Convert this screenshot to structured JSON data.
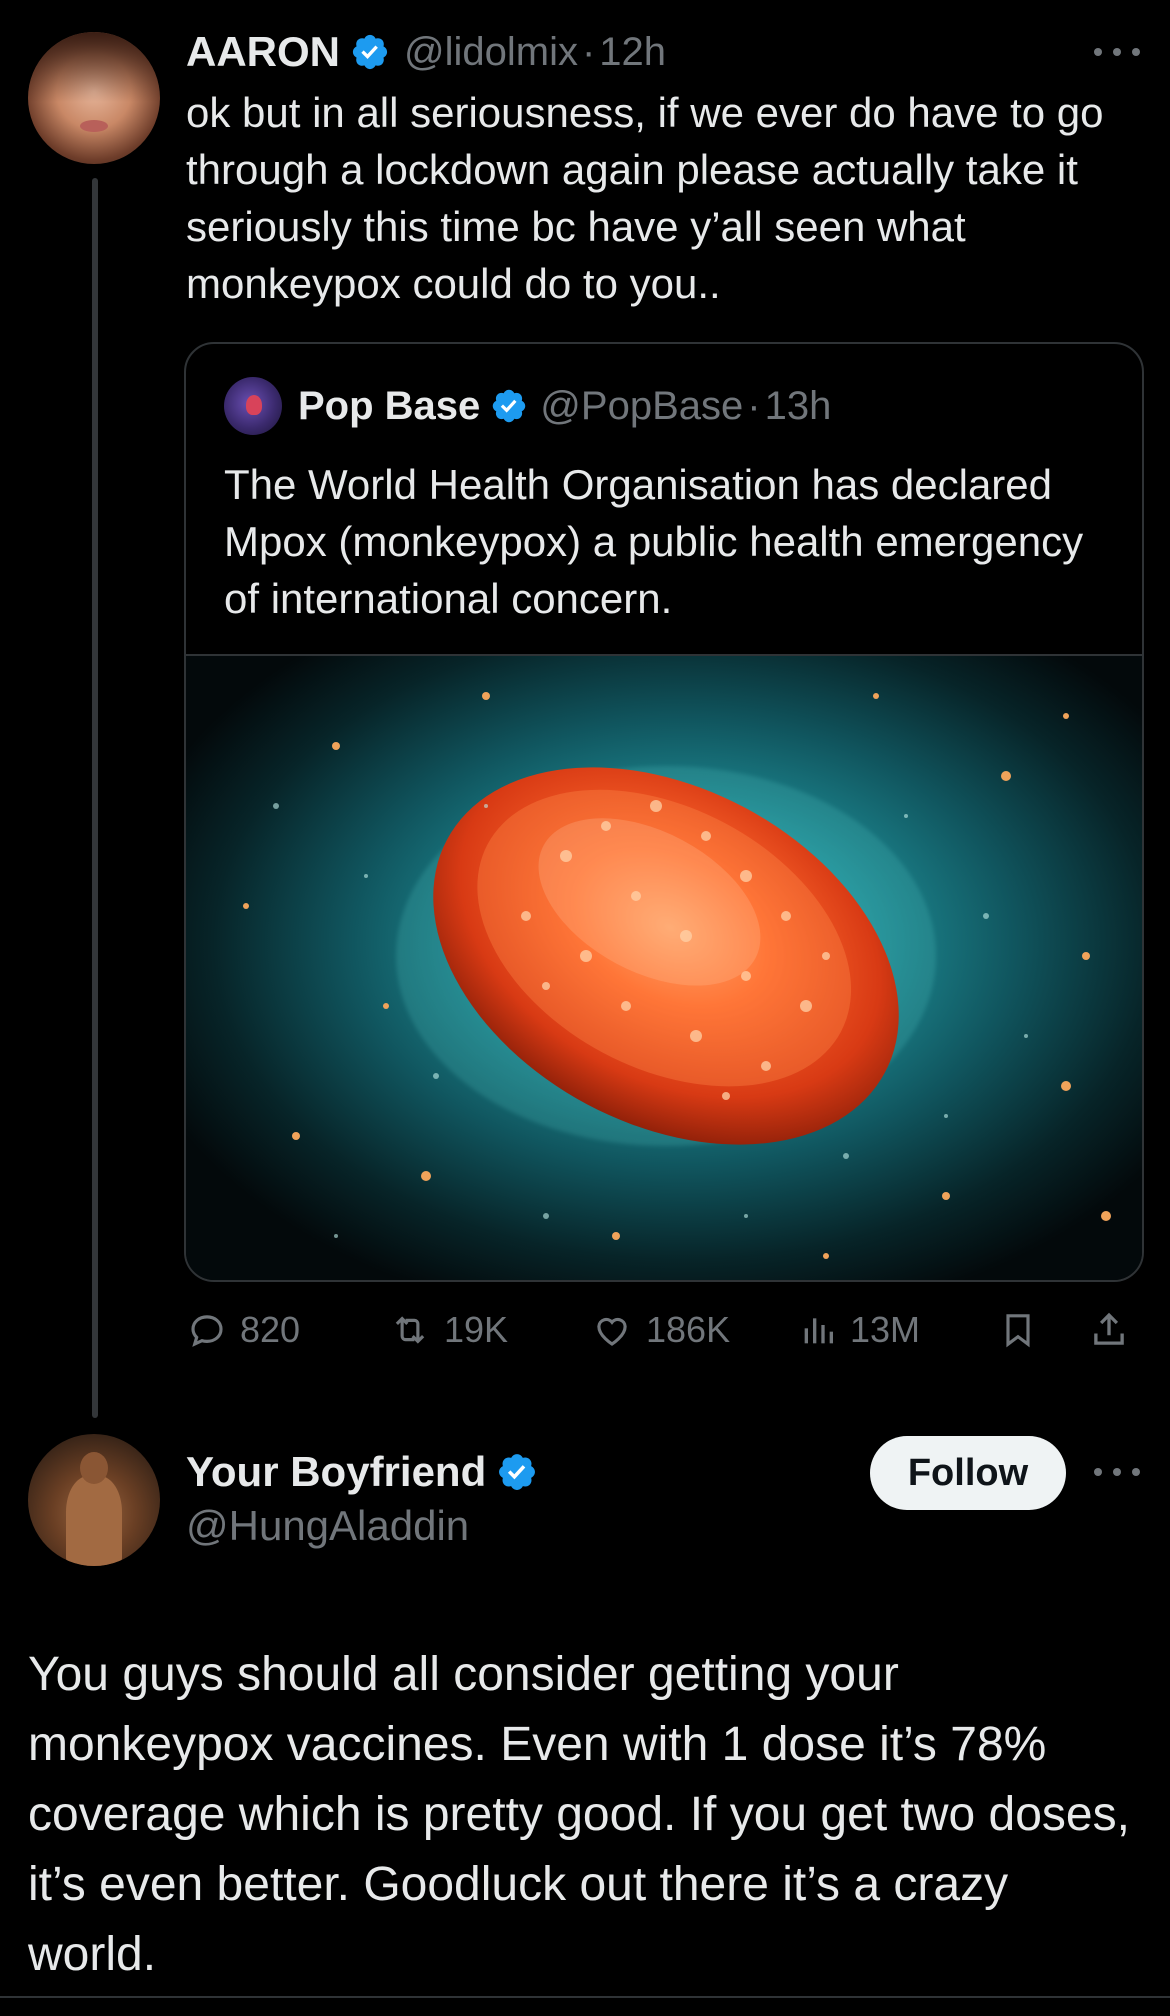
{
  "tweet1": {
    "author_name": "AARON",
    "handle": "@lidolmix",
    "separator": "·",
    "time": "12h",
    "text": "ok but in all seriousness, if we ever do have to go through a lockdown again please actually take it seriously this time bc have y’all seen what monkeypox could do to you..",
    "quoted": {
      "author_name": "Pop Base",
      "handle": "@PopBase",
      "separator": "·",
      "time": "13h",
      "text": "The World Health Organisation has declared Mpox (monkeypox) a public health emergency of international concern."
    },
    "actions": {
      "replies": "820",
      "reposts": "19K",
      "likes": "186K",
      "views": "13M"
    }
  },
  "tweet2": {
    "author_name": "Your Boyfriend",
    "handle": "@HungAladdin",
    "follow_label": "Follow",
    "text": "You guys should all consider getting your monkeypox vaccines. Even with 1 dose it’s 78% coverage which is pretty good. If you get two doses, it’s even better. Goodluck out there it’s a crazy world."
  },
  "colors": {
    "background": "#000000",
    "text": "#e7e9ea",
    "secondary": "#71767b",
    "verified": "#1d9bf0",
    "border": "#2f3336"
  }
}
